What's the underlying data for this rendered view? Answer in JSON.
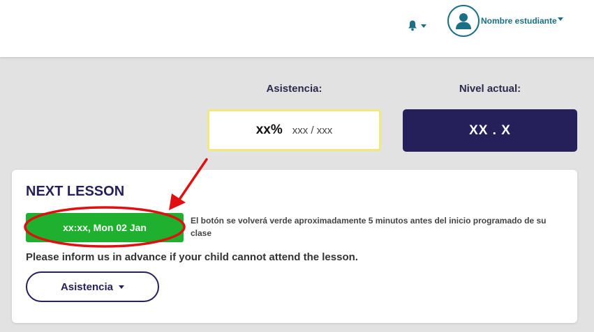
{
  "header": {
    "user_name": "Nombre estudiante"
  },
  "stats": {
    "attendance_label": "Asistencia:",
    "attendance_pct": "xx%",
    "attendance_count": "xxx / xxx",
    "level_label": "Nivel actual:",
    "level_value": "XX . X"
  },
  "next_lesson": {
    "title": "NEXT LESSON",
    "join_button": "xx:xx, Mon 02 Jan",
    "join_note": "El botón se volverá verde aproximadamente 5 minutos antes del inicio programado de su clase",
    "inform_text": "Please inform us in advance if your child cannot attend the lesson.",
    "attendance_button": "Asistencia"
  },
  "colors": {
    "accent_teal": "#1b6f85",
    "navy": "#25205a",
    "join_green": "#1fb030",
    "attendance_border": "#f1ea7a",
    "annotation_red": "#e01010"
  },
  "icons": [
    "bell-icon",
    "user-avatar-icon",
    "chevron-down-icon"
  ]
}
